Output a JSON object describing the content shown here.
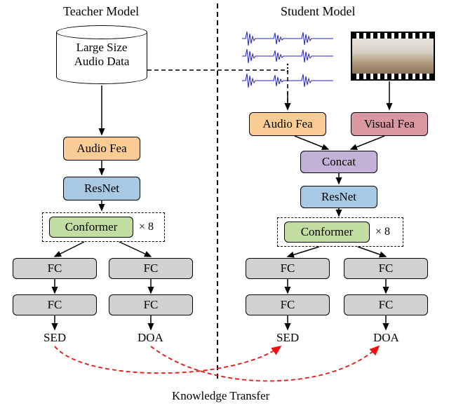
{
  "titles": {
    "teacher": "Teacher Model",
    "student": "Student Model"
  },
  "teacher": {
    "data_label_line1": "Large Size",
    "data_label_line2": "Audio Data",
    "audio_fea": "Audio Fea",
    "resnet": "ResNet",
    "conformer": "Conformer",
    "conformer_repeat": "× 8",
    "fc": "FC",
    "sed": "SED",
    "doa": "DOA"
  },
  "student": {
    "audio_fea": "Audio Fea",
    "visual_fea": "Visual Fea",
    "concat": "Concat",
    "resnet": "ResNet",
    "conformer": "Conformer",
    "conformer_repeat": "× 8",
    "fc": "FC",
    "sed": "SED",
    "doa": "DOA"
  },
  "knowledge_transfer": "Knowledge Transfer",
  "chart_data": {
    "type": "diagram",
    "description": "Teacher-student knowledge distillation architecture for audio-visual sound event detection (SED) and direction of arrival (DOA).",
    "teacher_pipeline": [
      "Large Size Audio Data",
      "Audio Fea",
      "ResNet",
      "Conformer ×8",
      [
        "FC→FC→SED",
        "FC→FC→DOA"
      ]
    ],
    "student_inputs": [
      "raw multichannel audio waveforms",
      "panoramic video frame"
    ],
    "student_pipeline": [
      "Audio Fea + Visual Fea",
      "Concat",
      "ResNet",
      "Conformer ×8",
      [
        "FC→FC→SED",
        "FC→FC→DOA"
      ]
    ],
    "knowledge_transfer_edges": [
      {
        "from": "Teacher SED",
        "to": "Student SED"
      },
      {
        "from": "Teacher DOA",
        "to": "Student DOA"
      }
    ],
    "shared_edge": {
      "from": "Large Size Audio Data",
      "to": "Student Audio Fea",
      "style": "dashed"
    }
  }
}
